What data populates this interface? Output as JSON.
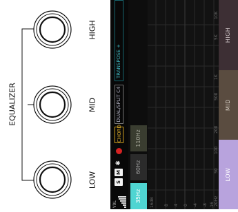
{
  "diagram": {
    "section_label": "EQUALIZER",
    "knobs": [
      {
        "label": "LOW"
      },
      {
        "label": "MID"
      },
      {
        "label": "HIGH"
      }
    ]
  },
  "screen": {
    "vol_label": "VOL",
    "s_label": "S",
    "m_label": "M",
    "bluetooth_glyph": "✱",
    "chord_label": "CHORD",
    "dual_split_label": "DUAL/SPLIT C4",
    "transpose_label": "TRANSPOSE +",
    "freq_tabs": [
      {
        "label": "35Hz",
        "active": true
      },
      {
        "label": "60Hz",
        "active": false
      },
      {
        "label": "110Hz",
        "active": false
      }
    ],
    "db_labels": [
      "16dB",
      "8",
      "4",
      "0",
      "-4",
      "-8",
      "-16"
    ],
    "freq_labels": [
      "20Hz",
      "50",
      "100",
      "200",
      "500",
      "1K",
      "5K",
      "10K"
    ],
    "bands": [
      {
        "label": "LOW",
        "active": true
      },
      {
        "label": "MID",
        "active": false
      },
      {
        "label": "HIGH",
        "active": false
      }
    ]
  },
  "colors": {
    "accent_teal": "#4fd5d2",
    "band_low": "#b8a3dd",
    "band_mid": "#5a4c40",
    "band_high": "#3d2f34",
    "chord_gold": "#d9a92a",
    "record_red": "#d62222"
  }
}
